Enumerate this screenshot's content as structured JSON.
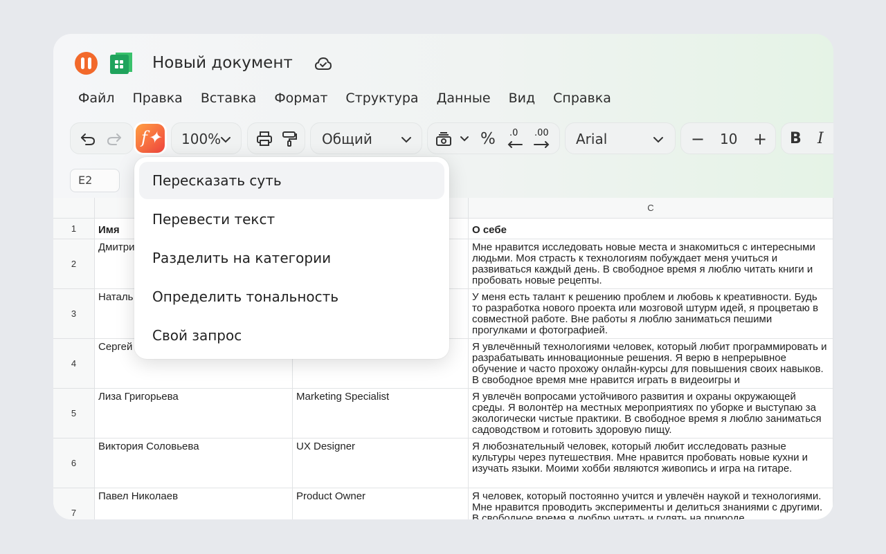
{
  "titlebar": {
    "doc_title": "Новый документ",
    "logo_color": "#f2692b",
    "sheet_icon_color": "#1fa35c"
  },
  "menu": [
    "Файл",
    "Правка",
    "Вставка",
    "Формат",
    "Структура",
    "Данные",
    "Вид",
    "Справка"
  ],
  "toolbar": {
    "zoom": "100%",
    "number_format": "Общий",
    "font_family": "Arial",
    "font_size": "10",
    "percent": "%",
    "decrease_decimals": ".0",
    "increase_decimals": ".00",
    "minus": "−",
    "plus": "+",
    "bold": "B",
    "italic": "I",
    "ai_glyph": "f✦",
    "ai_gradient": [
      "#ff9f43",
      "#f0443e"
    ]
  },
  "formula_bar": {
    "cell_ref": "E2"
  },
  "grid": {
    "column_headers": [
      "C"
    ],
    "rows": [
      {
        "num": "1",
        "name": "Имя",
        "role": "",
        "about": "О себе"
      },
      {
        "num": "2",
        "name": "Дмитри",
        "role": "",
        "about": "Мне нравится исследовать новые места и знакомиться с интересными людьми. Моя страсть к технологиям побуждает меня учиться и развиваться каждый день. В свободное время я люблю читать книги и пробовать новые рецепты."
      },
      {
        "num": "3",
        "name": "Наталь",
        "role": "",
        "about": "У меня есть талант к решению проблем и любовь к креативности. Будь то разработка нового проекта или мозговой штурм идей, я процветаю в совместной работе. Вне работы я люблю заниматься пешими прогулками и фотографией."
      },
      {
        "num": "4",
        "name": "Сергей",
        "role": "",
        "about": "Я увлечённый технологиями человек, который любит программировать и разрабатывать инновационные решения. Я верю в непрерывное обучение и часто прохожу онлайн-курсы для повышения своих навыков. В свободное время мне нравится играть в видеоигры и"
      },
      {
        "num": "5",
        "name": "Лиза Григорьева",
        "role": "Marketing Specialist",
        "about": "Я увлечён вопросами устойчивого развития и охраны окружающей среды. Я волонтёр на местных мероприятиях по уборке и выступаю за экологически чистые практики. В свободное время я люблю заниматься садоводством и готовить здоровую пищу."
      },
      {
        "num": "6",
        "name": "Виктория Соловьева",
        "role": "UX Designer",
        "about": "Я любознательный человек, который любит исследовать разные культуры через путешествия. Мне нравится пробовать новые кухни и изучать языки. Моими хобби являются живопись и игра на гитаре."
      },
      {
        "num": "7",
        "name": "Павел Николаев",
        "role": "Product Owner",
        "about": "Я человек, который постоянно учится и увлечён наукой и технологиями. Мне нравится проводить эксперименты и делиться знаниями с другими. В свободное время я люблю читать и гулять на природе."
      }
    ]
  },
  "ai_menu": {
    "items": [
      "Пересказать суть",
      "Перевести текст",
      "Разделить на категории",
      "Определить тональность",
      "Свой запрос"
    ],
    "active_index": 0
  }
}
